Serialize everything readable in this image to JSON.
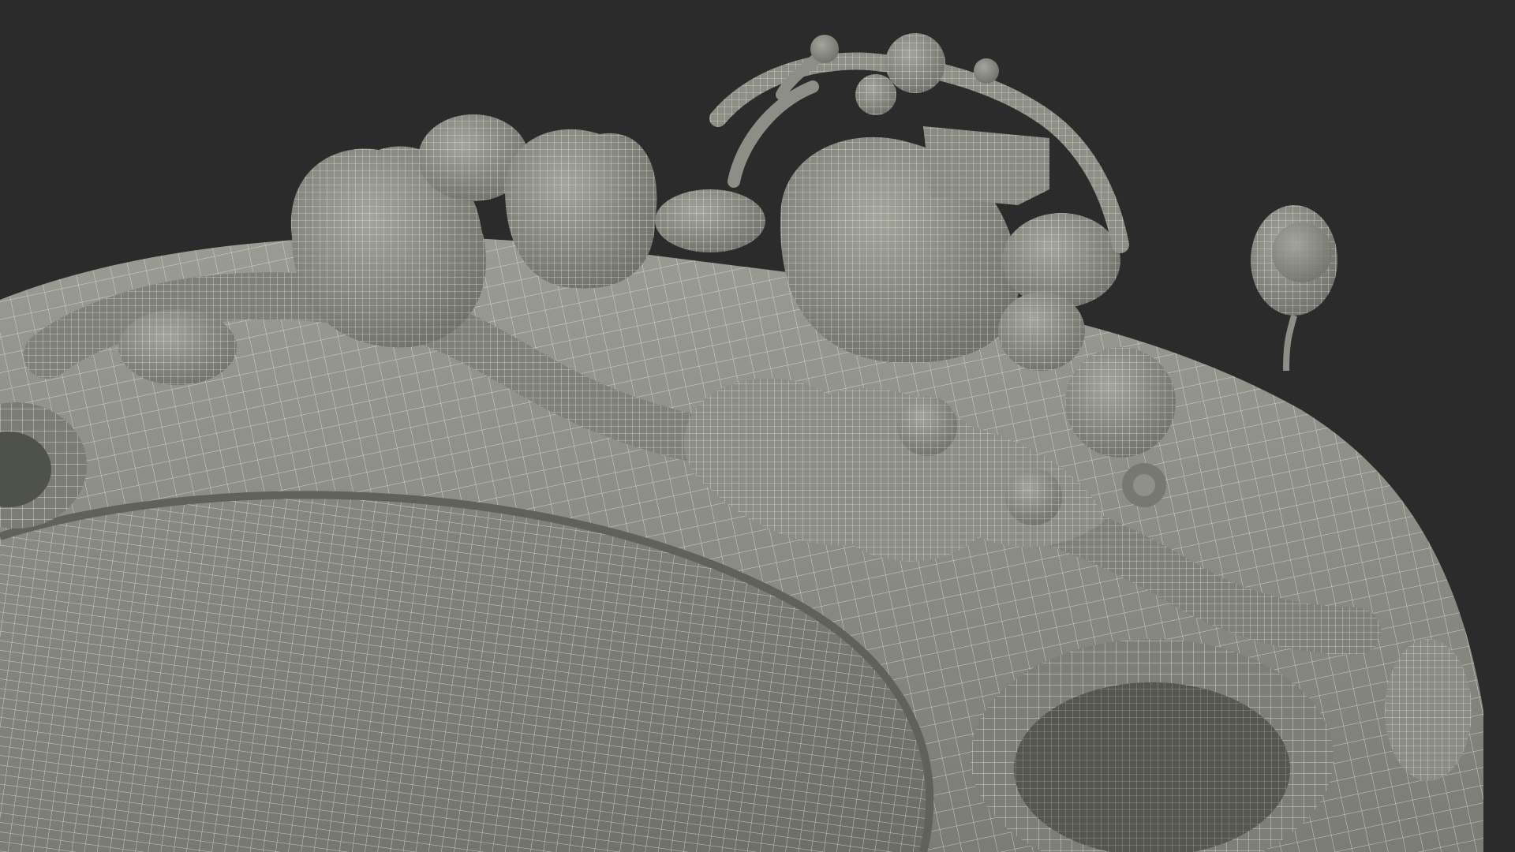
{
  "scene": {
    "background_color": "#2b2b2b",
    "model_surface_color": "#8a8c84",
    "wireframe_color": "#f2f2ec",
    "subject": "wireframe-3d-model-render"
  }
}
